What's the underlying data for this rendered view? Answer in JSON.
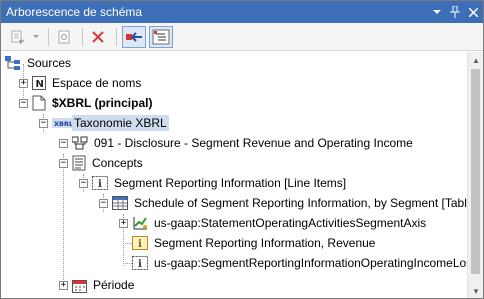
{
  "window": {
    "title": "Arborescence de schéma"
  },
  "titlebar_buttons": [
    "dropdown-icon",
    "pin-icon",
    "close-icon"
  ],
  "toolbar": [
    "add-node-icon",
    "dropdown-icon",
    "settings-icon",
    "delete-icon",
    "sync-back-icon",
    "sync-tree-icon"
  ],
  "tree": {
    "sources": "Sources",
    "namespaces": "Espace de noms",
    "xbrl": "$XBRL (principal)",
    "taxonomy": "Taxonomie XBRL",
    "taxonomy_icon_text": "XBRL",
    "disclosure": "091 - Disclosure - Segment Revenue and Operating Income",
    "concepts": "Concepts",
    "line_items": "Segment Reporting Information [Line Items]",
    "table": "Schedule of Segment Reporting Information, by Segment [Table]",
    "axis": "us-gaap:StatementOperatingActivitiesSegmentAxis",
    "revenue": "Segment Reporting Information, Revenue",
    "operating_income": "us-gaap:SegmentReportingInformationOperatingIncomeLossAbstr",
    "period": "Période"
  },
  "icon_letters": {
    "namespace": "N",
    "item": "i"
  },
  "colors": {
    "titlebar": "#3d6eb8",
    "selection": "#cfdcf0",
    "delete": "#d93a3a"
  }
}
